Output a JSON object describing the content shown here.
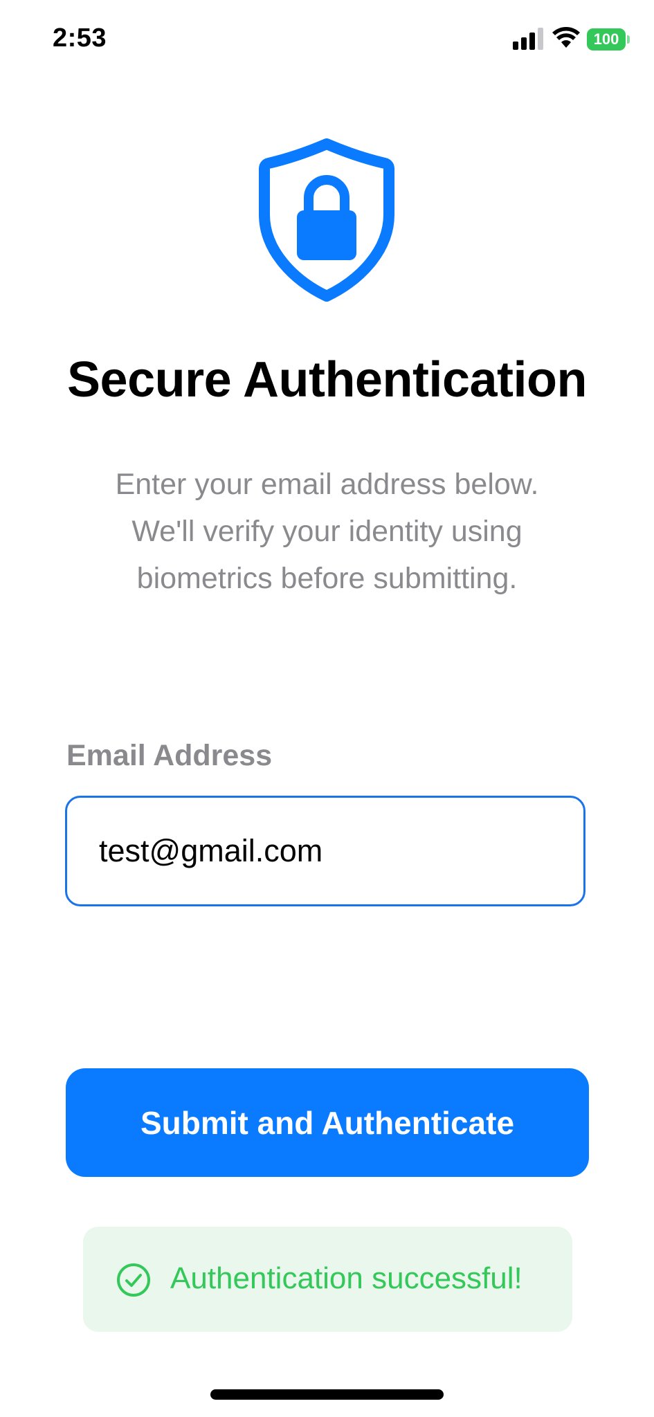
{
  "status_bar": {
    "time": "2:53",
    "battery_level": "100",
    "icons": [
      "signal-icon",
      "wifi-icon",
      "battery-icon"
    ]
  },
  "hero": {
    "icon": "shield-lock-icon",
    "title": "Secure Authentication",
    "subtitle_lines": [
      "Enter your email address below.",
      "We'll verify your identity using",
      "biometrics before submitting."
    ]
  },
  "form": {
    "email_label": "Email Address",
    "email_value": "test@gmail.com",
    "submit_label": "Submit and Authenticate"
  },
  "status_message": {
    "icon": "check-circle-icon",
    "text": "Authentication successful!"
  },
  "colors": {
    "accent": "#0a7aff",
    "field_border": "#1a73e8",
    "success": "#34c759",
    "success_background": "#e9f7ec",
    "secondary_text": "#8a8a8e"
  }
}
